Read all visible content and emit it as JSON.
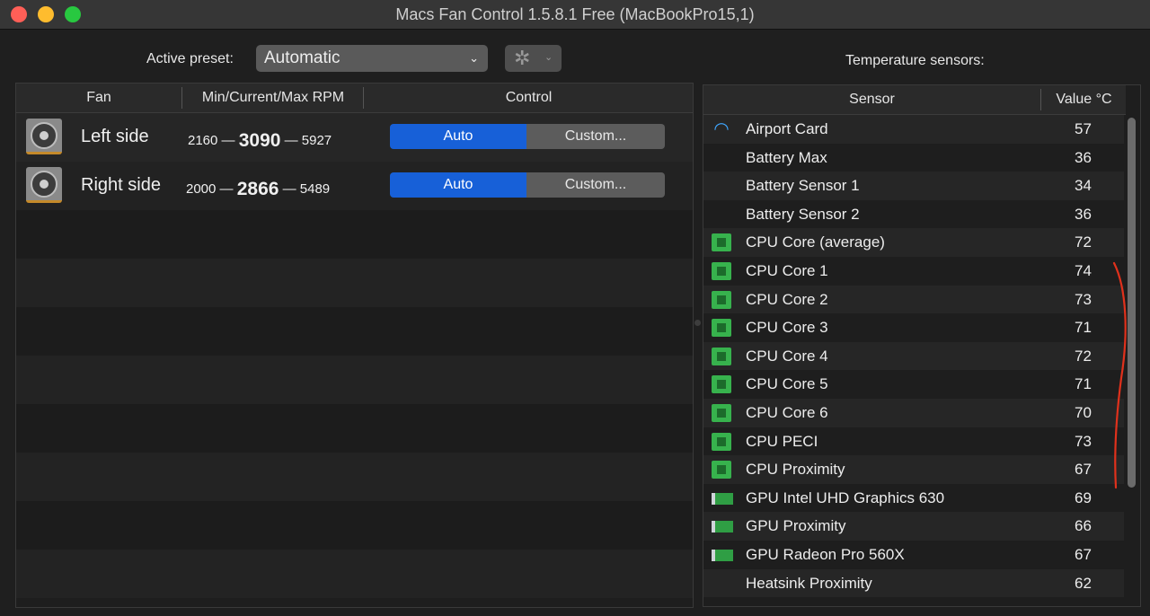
{
  "window": {
    "title": "Macs Fan Control 1.5.8.1 Free (MacBookPro15,1)"
  },
  "toolbar": {
    "preset_label": "Active preset:",
    "preset_value": "Automatic",
    "sensors_title": "Temperature sensors:"
  },
  "fan_table": {
    "headers": {
      "fan": "Fan",
      "rpm": "Min/Current/Max RPM",
      "control": "Control"
    },
    "rows": [
      {
        "name": "Left side",
        "min": "2160",
        "current": "3090",
        "max": "5927",
        "auto_label": "Auto",
        "custom_label": "Custom..."
      },
      {
        "name": "Right side",
        "min": "2000",
        "current": "2866",
        "max": "5489",
        "auto_label": "Auto",
        "custom_label": "Custom..."
      }
    ]
  },
  "sensor_table": {
    "headers": {
      "sensor": "Sensor",
      "value": "Value °C"
    },
    "rows": [
      {
        "name": "Airport Card",
        "value": "57",
        "icon": "wifi-icon"
      },
      {
        "name": "Battery Max",
        "value": "36",
        "icon": ""
      },
      {
        "name": "Battery Sensor 1",
        "value": "34",
        "icon": ""
      },
      {
        "name": "Battery Sensor 2",
        "value": "36",
        "icon": ""
      },
      {
        "name": "CPU Core (average)",
        "value": "72",
        "icon": "cpu-chip-icon"
      },
      {
        "name": "CPU Core 1",
        "value": "74",
        "icon": "cpu-chip-icon"
      },
      {
        "name": "CPU Core 2",
        "value": "73",
        "icon": "cpu-chip-icon"
      },
      {
        "name": "CPU Core 3",
        "value": "71",
        "icon": "cpu-chip-icon"
      },
      {
        "name": "CPU Core 4",
        "value": "72",
        "icon": "cpu-chip-icon"
      },
      {
        "name": "CPU Core 5",
        "value": "71",
        "icon": "cpu-chip-icon"
      },
      {
        "name": "CPU Core 6",
        "value": "70",
        "icon": "cpu-chip-icon"
      },
      {
        "name": "CPU PECI",
        "value": "73",
        "icon": "cpu-chip-icon"
      },
      {
        "name": "CPU Proximity",
        "value": "67",
        "icon": "cpu-chip-icon"
      },
      {
        "name": "GPU Intel UHD Graphics 630",
        "value": "69",
        "icon": "gpu-card-icon"
      },
      {
        "name": "GPU Proximity",
        "value": "66",
        "icon": "gpu-card-icon"
      },
      {
        "name": "GPU Radeon Pro 560X",
        "value": "67",
        "icon": "gpu-card-icon"
      },
      {
        "name": "Heatsink Proximity",
        "value": "62",
        "icon": ""
      }
    ]
  },
  "colors": {
    "accent_blue": "#1760d8",
    "annotation_red": "#e0311c",
    "chip_green": "#37b24d"
  }
}
